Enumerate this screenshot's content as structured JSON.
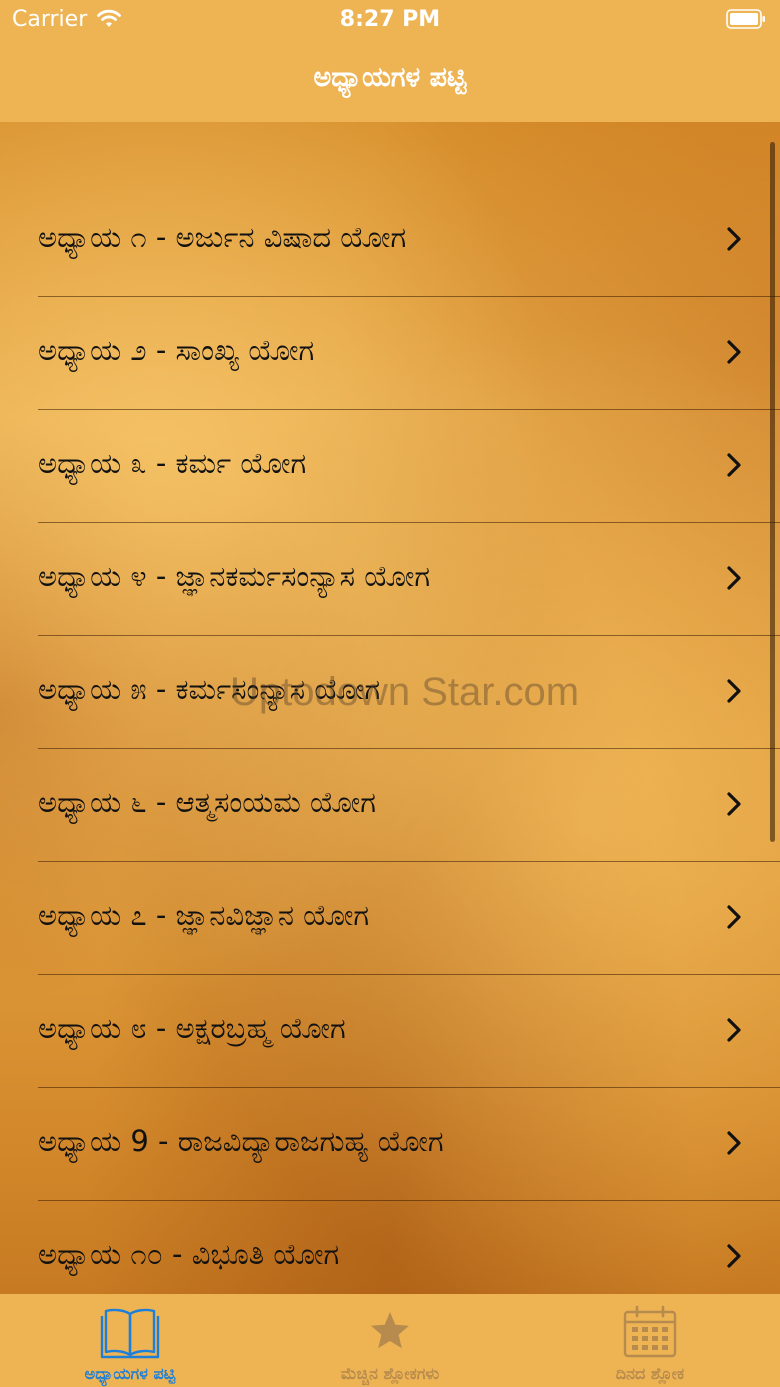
{
  "status_bar": {
    "carrier": "Carrier",
    "time": "8:27 PM"
  },
  "nav": {
    "title": "ಅಧ್ಯಾಯಗಳ ಪಟ್ಟಿ"
  },
  "watermark": "Uptodown Star.com",
  "chapters": [
    {
      "label": "ಅಧ್ಯಾಯ ೧ - ಅರ್ಜುನ ವಿಷಾದ ಯೋಗ"
    },
    {
      "label": "ಅಧ್ಯಾಯ ೨ - ಸಾಂಖ್ಯ ಯೋಗ"
    },
    {
      "label": "ಅಧ್ಯಾಯ ೩ - ಕರ್ಮ ಯೋಗ"
    },
    {
      "label": "ಅಧ್ಯಾಯ ೪ - ಜ್ಞಾನಕರ್ಮಸಂನ್ಯಾಸ ಯೋಗ"
    },
    {
      "label": "ಅಧ್ಯಾಯ ೫ - ಕರ್ಮಸಂನ್ಯಾಸ ಯೋಗ"
    },
    {
      "label": "ಅಧ್ಯಾಯ ೬ - ಆತ್ಮಸಂಯಮ ಯೋಗ"
    },
    {
      "label": "ಅಧ್ಯಾಯ ೭ - ಜ್ಞಾನವಿಜ್ಞಾನ ಯೋಗ"
    },
    {
      "label": "ಅಧ್ಯಾಯ ೮ - ಅಕ್ಷರಬ್ರಹ್ಮ ಯೋಗ"
    },
    {
      "label": "ಅಧ್ಯಾಯ 9 - ರಾಜವಿದ್ಯಾರಾಜಗುಹ್ಯ ಯೋಗ"
    },
    {
      "label": "ಅಧ್ಯಾಯ ೧೦ - ವಿಭೂತಿ ಯೋಗ"
    }
  ],
  "tabs": [
    {
      "label": "ಅಧ್ಯಾಯಗಳ ಪಟ್ಟಿ",
      "icon": "book-icon",
      "active": true
    },
    {
      "label": "ಮೆಚ್ಚಿನ ಶ್ಲೋಕಗಳು",
      "icon": "star-icon",
      "active": false
    },
    {
      "label": "ದಿನದ ಶ್ಲೋಕ",
      "icon": "calendar-icon",
      "active": false
    }
  ],
  "colors": {
    "bar_background": "#eeb453",
    "active_tab": "#1e7fd8",
    "inactive_tab": "#b78a4e"
  }
}
